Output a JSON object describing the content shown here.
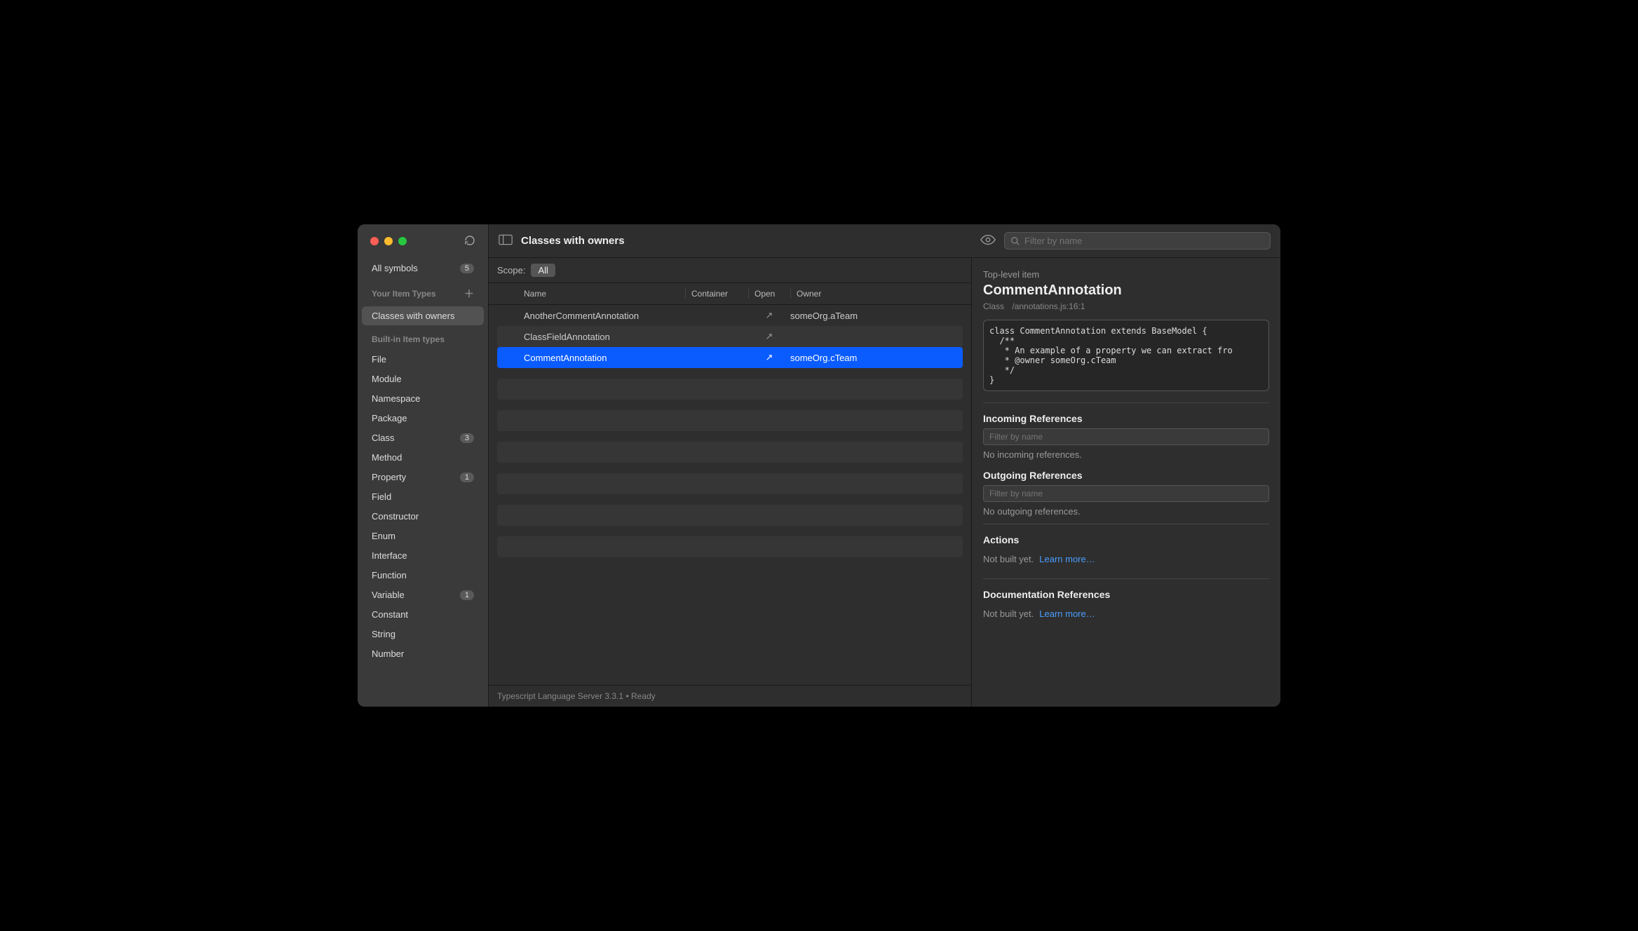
{
  "sidebar": {
    "all_symbols": {
      "label": "All symbols",
      "count": "5"
    },
    "your_types_heading": "Your Item Types",
    "your_types": [
      {
        "label": "Classes with owners",
        "active": true
      }
    ],
    "builtin_heading": "Built-in Item types",
    "builtin": [
      {
        "label": "File",
        "count": null
      },
      {
        "label": "Module",
        "count": null
      },
      {
        "label": "Namespace",
        "count": null
      },
      {
        "label": "Package",
        "count": null
      },
      {
        "label": "Class",
        "count": "3"
      },
      {
        "label": "Method",
        "count": null
      },
      {
        "label": "Property",
        "count": "1"
      },
      {
        "label": "Field",
        "count": null
      },
      {
        "label": "Constructor",
        "count": null
      },
      {
        "label": "Enum",
        "count": null
      },
      {
        "label": "Interface",
        "count": null
      },
      {
        "label": "Function",
        "count": null
      },
      {
        "label": "Variable",
        "count": "1"
      },
      {
        "label": "Constant",
        "count": null
      },
      {
        "label": "String",
        "count": null
      },
      {
        "label": "Number",
        "count": null
      }
    ]
  },
  "toolbar": {
    "title": "Classes with owners",
    "search_placeholder": "Filter by name"
  },
  "scope": {
    "label": "Scope:",
    "value": "All"
  },
  "columns": {
    "name": "Name",
    "container": "Container",
    "open": "Open",
    "owner": "Owner"
  },
  "rows": [
    {
      "name": "AnotherCommentAnnotation",
      "container": "",
      "owner": "someOrg.aTeam",
      "selected": false
    },
    {
      "name": "ClassFieldAnnotation",
      "container": "",
      "owner": "",
      "selected": false
    },
    {
      "name": "CommentAnnotation",
      "container": "",
      "owner": "someOrg.cTeam",
      "selected": true
    }
  ],
  "open_icon": "↗",
  "status": "Typescript Language Server 3.3.1 • Ready",
  "detail": {
    "subtitle": "Top-level item",
    "title": "CommentAnnotation",
    "kind": "Class",
    "path": "/annotations.js:16:1",
    "code": "class CommentAnnotation extends BaseModel {\n  /**\n   * An example of a property we can extract fro\n   * @owner someOrg.cTeam\n   */\n}",
    "incoming_title": "Incoming References",
    "incoming_filter_placeholder": "Filter by name",
    "incoming_empty": "No incoming references.",
    "outgoing_title": "Outgoing References",
    "outgoing_filter_placeholder": "Filter by name",
    "outgoing_empty": "No outgoing references.",
    "actions_title": "Actions",
    "not_built": "Not built yet.",
    "learn_more": "Learn more…",
    "doc_refs_title": "Documentation References"
  }
}
